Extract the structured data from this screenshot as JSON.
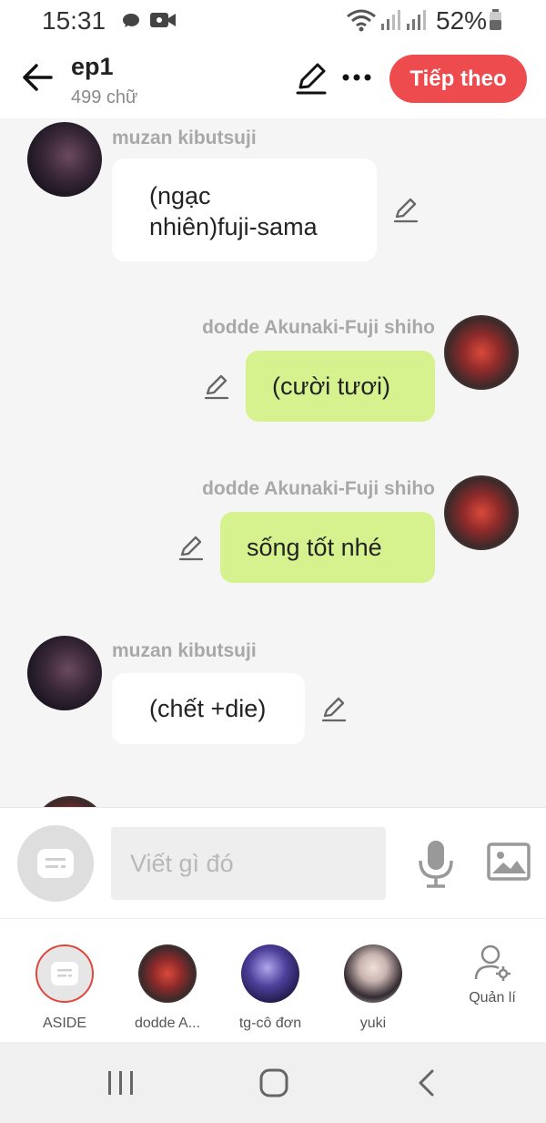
{
  "status_bar": {
    "time": "15:31",
    "battery": "52%",
    "icons": [
      "chat-bubble-icon",
      "video-icon",
      "wifi-icon",
      "signal-icon",
      "signal-icon",
      "battery-icon"
    ]
  },
  "header": {
    "title": "ep1",
    "subtitle": "499 chữ",
    "next_label": "Tiếp theo",
    "accent_color": "#ee4b4f"
  },
  "messages": [
    {
      "sender": "muzan kibutsuji",
      "text_lines": [
        "(ngạc",
        "nhiên)fuji-sama"
      ],
      "side": "left"
    },
    {
      "sender": "dodde Akunaki-Fuji shiho",
      "text": "(cười tươi)",
      "side": "right"
    },
    {
      "sender": "dodde Akunaki-Fuji shiho",
      "text": "sống tốt nhé",
      "side": "right"
    },
    {
      "sender": "muzan kibutsuji",
      "text": "(chết +die)",
      "side": "left"
    }
  ],
  "composer": {
    "placeholder": "Viết gì đó"
  },
  "characters": [
    {
      "label": "ASIDE"
    },
    {
      "label": "dodde A..."
    },
    {
      "label": "tg-cô đơn"
    },
    {
      "label": "yuki"
    },
    {
      "label": "Quản lí"
    }
  ],
  "colors": {
    "bubble_self": "#d6f28e",
    "bubble_other": "#ffffff",
    "sender_name": "#a8a8a8"
  }
}
